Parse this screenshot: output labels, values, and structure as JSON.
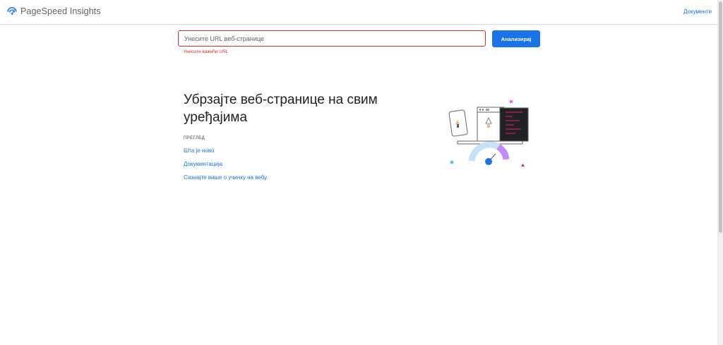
{
  "header": {
    "brand": "PageSpeed Insights",
    "docs_link": "Документи"
  },
  "form": {
    "url_placeholder": "Унесите URL веб-странице",
    "url_value": "",
    "error": "Унесите важећи URL",
    "analyze_button": "Анализирај"
  },
  "hero": {
    "title": "Убрзајте веб-странице на свим уређајима",
    "section_label": "ПРЕГЛЕД",
    "links": [
      "Шта је ново",
      "Документација",
      "Сазнајте више о учинку на вебу"
    ]
  },
  "colors": {
    "accent": "#1a73e8",
    "error": "#d93025"
  }
}
